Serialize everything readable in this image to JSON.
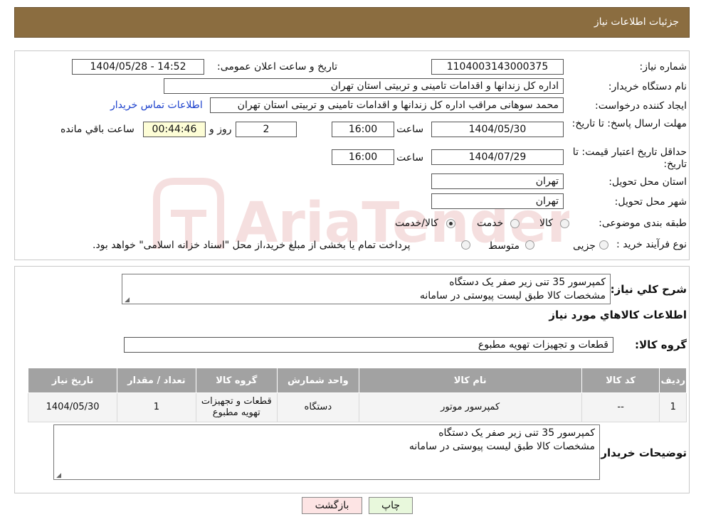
{
  "header": {
    "title": "جزئیات اطلاعات نیاز"
  },
  "form": {
    "need_number_label": "شماره نیاز:",
    "need_number": "1104003143000375",
    "announce_label": "تاریخ و ساعت اعلان عمومی:",
    "announce_value": "1404/05/28 - 14:52",
    "buyer_label": "نام دستگاه خریدار:",
    "buyer_value": "اداره کل زندانها و اقدامات تامینی و تربیتی استان تهران",
    "creator_label": "ایجاد کننده درخواست:",
    "creator_value": "محمد سوهانی مراقب  اداره کل زندانها و اقدامات تامینی و تربیتی استان تهران",
    "contact_link": "اطلاعات تماس خریدار",
    "deadline_label": "مهلت ارسال پاسخ: تا تاریخ:",
    "deadline_date": "1404/05/30",
    "time_label": "ساعت",
    "deadline_time": "16:00",
    "days_value": "2",
    "days_label": "روز و",
    "remaining_value": "00:44:46",
    "remaining_label": "ساعت باقي مانده",
    "validity_label": "حداقل تاریخ اعتبار قیمت: تا تاریخ:",
    "validity_date": "1404/07/29",
    "validity_time": "16:00",
    "province_label": "استان محل تحویل:",
    "province_value": "تهران",
    "city_label": "شهر محل تحویل:",
    "city_value": "تهران",
    "category_label": "طبقه بندی موضوعی:",
    "category_options": [
      "کالا",
      "خدمت",
      "کالا/خدمت"
    ],
    "process_label": "نوع فرآیند خرید :",
    "process_options": [
      "جزیی",
      "متوسط"
    ],
    "process_note": "پرداخت تمام یا بخشی از مبلغ خرید،از محل \"اسناد خزانه اسلامی\" خواهد بود."
  },
  "details": {
    "summary_label": "شرح کلي نياز:",
    "summary_line1": "کمپرسور 35 تنی زیر صفر یک دستگاه",
    "summary_line2": "مشخصات کالا طبق لیست پیوستی در سامانه",
    "items_heading": "اطلاعات کالاهاي مورد نياز",
    "group_label": "گروه کالا:",
    "group_value": "قطعات و تجهیزات تهویه مطبوع"
  },
  "table": {
    "headers": [
      "رديف",
      "کد کالا",
      "نام کالا",
      "واحد شمارش",
      "گروه کالا",
      "تعداد / مقدار",
      "تاریخ نیاز"
    ],
    "rows": [
      {
        "row": "1",
        "code": "--",
        "name": "کمپرسور موتور",
        "unit": "دستگاه",
        "group_line1": "قطعات و تجهیزات",
        "group_line2": "تهویه مطبوع",
        "qty": "1",
        "date": "1404/05/30"
      }
    ]
  },
  "buyer_notes": {
    "label": "توضیحات خریدار:",
    "line1": "کمپرسور 35 تنی زیر صفر یک دستگاه",
    "line2": "مشخصات کالا طبق لیست پیوستی در سامانه"
  },
  "buttons": {
    "print": "چاپ",
    "back": "بازگشت"
  },
  "watermark": {
    "text": "AriaTender.neT"
  },
  "colors": {
    "header_bg": "#8b6d40",
    "table_header": "#a2a2a2",
    "back_btn": "#fde4e4",
    "print_btn": "#e8f8dc",
    "timer_bg": "#fdfdd6",
    "link": "#1a3fcc"
  }
}
